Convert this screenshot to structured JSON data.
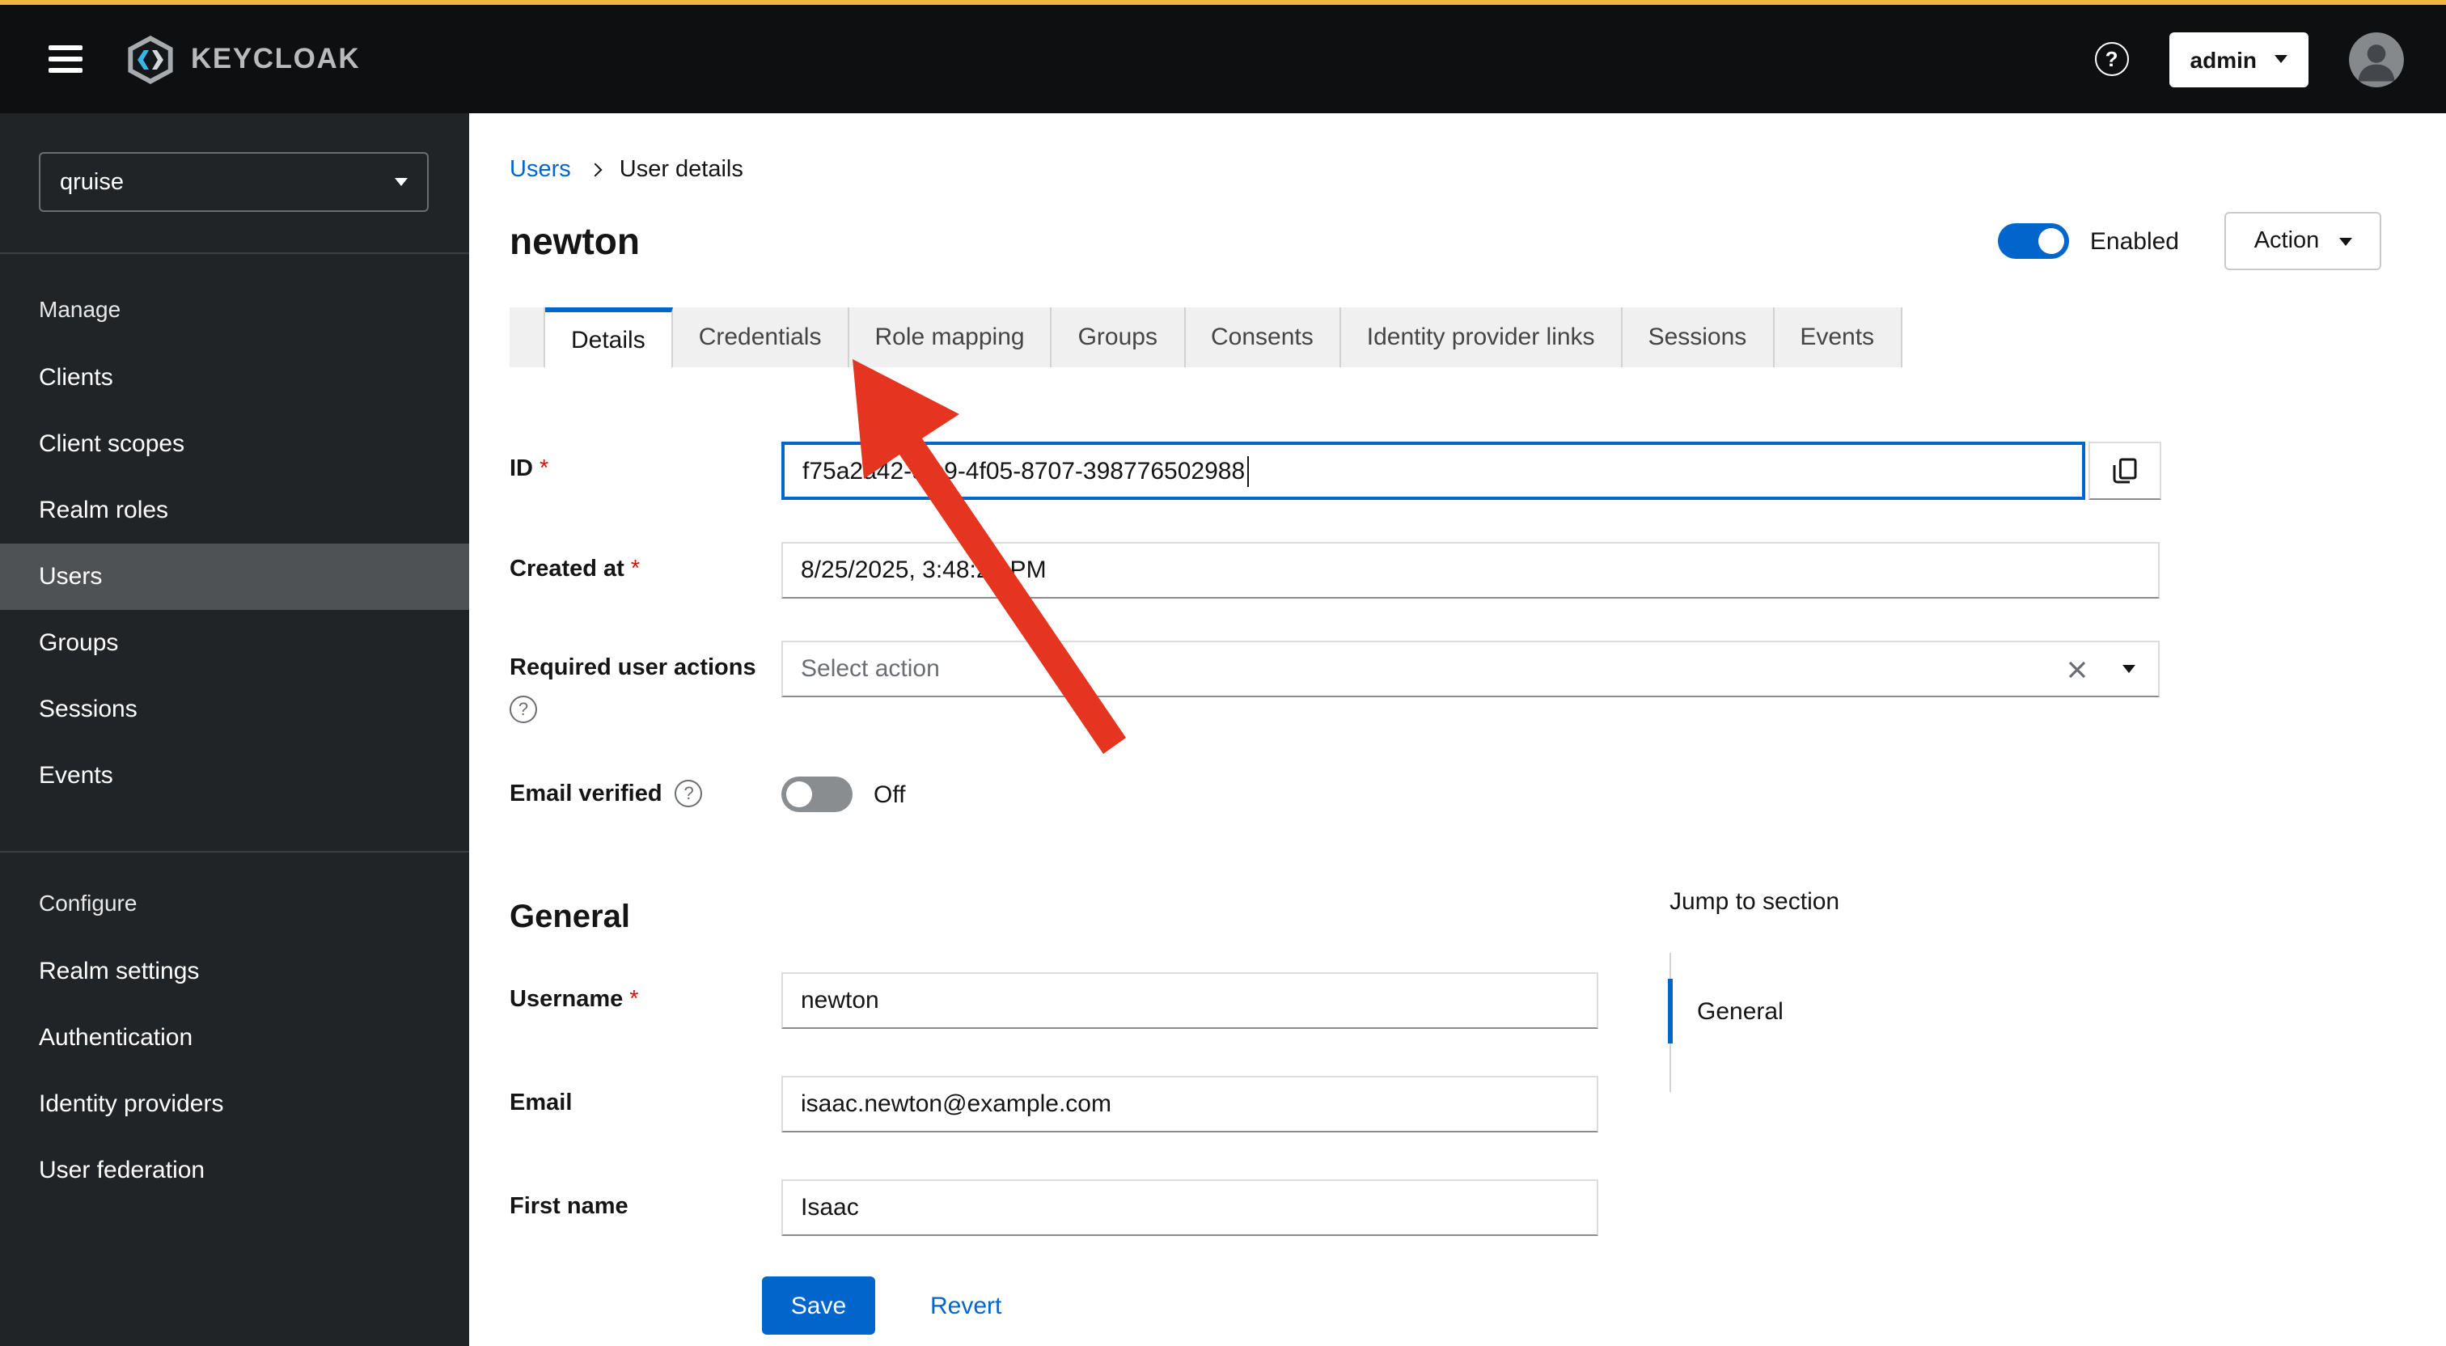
{
  "masthead": {
    "brand": "KEYCLOAK",
    "user": "admin"
  },
  "icons": {
    "help_glyph": "?",
    "required_glyph": "*"
  },
  "sidebar": {
    "realm": "qruise",
    "selected_item": "Users",
    "sections": [
      {
        "label": "Manage",
        "items": [
          "Clients",
          "Client scopes",
          "Realm roles",
          "Users",
          "Groups",
          "Sessions",
          "Events"
        ]
      },
      {
        "label": "Configure",
        "items": [
          "Realm settings",
          "Authentication",
          "Identity providers",
          "User federation"
        ]
      }
    ]
  },
  "breadcrumb": {
    "items": [
      "Users",
      "User details"
    ]
  },
  "page": {
    "title": "newton",
    "enabled_label": "Enabled",
    "enabled_state": "on",
    "action_label": "Action"
  },
  "tabs": [
    "Details",
    "Credentials",
    "Role mapping",
    "Groups",
    "Consents",
    "Identity provider links",
    "Sessions",
    "Events"
  ],
  "active_tab": "Details",
  "form": {
    "id": {
      "label": "ID",
      "required": true,
      "value": "f75a2a42-9fc9-4f05-8707-398776502988"
    },
    "created_at": {
      "label": "Created at",
      "required": true,
      "value": "8/25/2025, 3:48:28 PM"
    },
    "required_user_actions": {
      "label": "Required user actions",
      "placeholder": "Select action"
    },
    "email_verified": {
      "label": "Email verified",
      "state_label": "Off",
      "state": "off"
    },
    "general_heading": "General",
    "username": {
      "label": "Username",
      "required": true,
      "value": "newton"
    },
    "email": {
      "label": "Email",
      "value": "isaac.newton@example.com"
    },
    "first_name": {
      "label": "First name",
      "value": "Isaac"
    }
  },
  "jump": {
    "title": "Jump to section",
    "items": [
      "General"
    ]
  },
  "actions": {
    "save": "Save",
    "revert": "Revert"
  },
  "colors": {
    "accent": "#0066cc",
    "link": "#0066cc",
    "top_stripe": "#ecb73a",
    "masthead_bg": "#0d0f11",
    "sidebar_bg": "#212427",
    "sidebar_selected": "#4f5255",
    "sidebar_divider": "#3b3e42",
    "tab_bg": "#f0f0f0",
    "border": "#d2d2d2",
    "input_border_bottom": "#8a8d90",
    "text": "#151515",
    "muted": "#6a6e73",
    "required": "#c9190b",
    "toggle_off": "#8a8d90",
    "arrow": "#e5341f"
  }
}
